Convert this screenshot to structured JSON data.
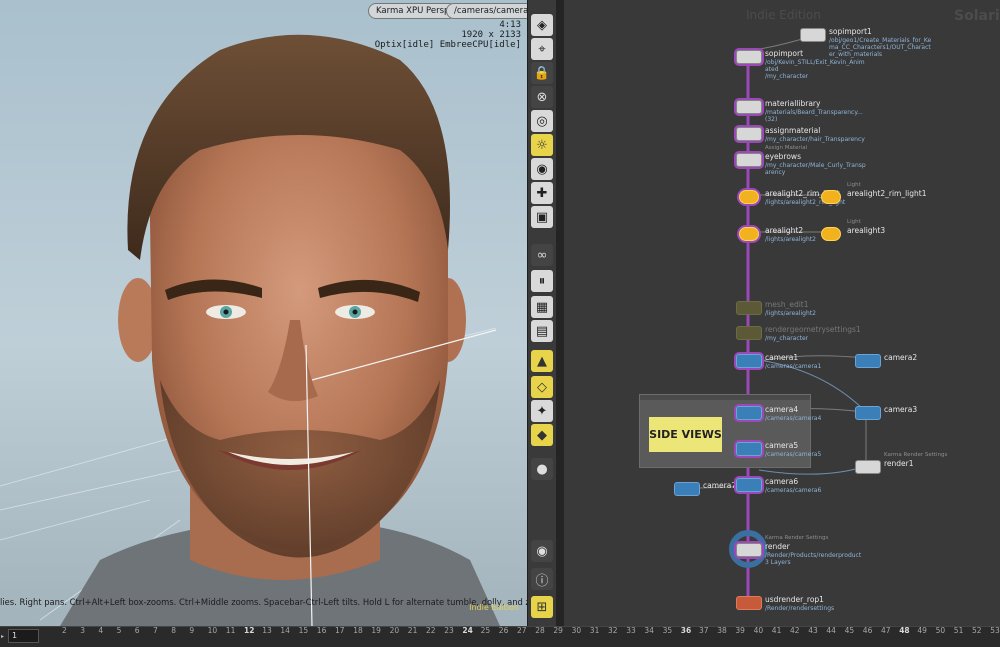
{
  "viewport": {
    "renderer_menu": "Karma XPU Persp",
    "camera_menu": "/cameras/camera4",
    "stats": [
      "4:13",
      "1920 x 2133",
      "Optix[idle] EmbreeCPU[idle]"
    ],
    "help_text": "lies. Right pans. Ctrl+Alt+Left box-zooms. Ctrl+Middle zooms. Spacebar-Ctrl-Left tilts. Hold L for alternate tumble, dolly, and zoom. M or Alt+M for First",
    "edition_label": "Indie Edition"
  },
  "toolbar": {
    "icons": [
      "display-options-icon",
      "snapping-icon",
      "lock-camera-icon",
      "disable-selection-icon",
      "camera-look-icon",
      "light-toggle-icon",
      "headlight-icon",
      "shading-icon",
      "render-region-icon",
      "link-icon",
      "pause-render-icon",
      "ghost-icon",
      "display-geometry-icon",
      "guides-icon",
      "background-icon",
      "grid-icon",
      "snapshot-icon",
      "view-visibility-icon",
      "info-icon",
      "layout-icon"
    ]
  },
  "network": {
    "title": "Indie Edition",
    "brand": "Solaris",
    "sticky_note": "SIDE VIEWS",
    "nodes": [
      {
        "id": "sopimport1",
        "name": "sopimport1",
        "path": "/obj/geo1/Create_Materials_for_Ke\nma_CC_Characters1/OUT_Charact\ner_with_materials",
        "comment": "",
        "kind": "lop",
        "dim": false
      },
      {
        "id": "sopimport",
        "name": "sopimport",
        "path": "/obj/Kevin_STILL/Exit_Kevin_Anim\nated\n/my_character",
        "comment": "",
        "kind": "lop",
        "dim": false
      },
      {
        "id": "materiallibrary",
        "name": "materiallibrary",
        "path": "/materials/Beard_Transparency...\n(32)",
        "comment": "",
        "kind": "lop",
        "dim": false
      },
      {
        "id": "assignmaterial",
        "name": "assignmaterial",
        "path": "/my_character/hair_Transparency",
        "comment": "",
        "kind": "lop",
        "dim": false
      },
      {
        "id": "eyebrows",
        "name": "eyebrows",
        "path": "/my_character/Male_Curly_Transp\narency",
        "comment": "Assign Material",
        "kind": "lop",
        "dim": false
      },
      {
        "id": "arealight2_rim_light",
        "name": "arealight2_rim_light",
        "path": "/lights/arealight2_rim_light",
        "comment": "",
        "kind": "light",
        "dim": false
      },
      {
        "id": "arealight2_rim_light1",
        "name": "arealight2_rim_light1",
        "path": "",
        "comment": "Light",
        "kind": "light",
        "dim": false
      },
      {
        "id": "arealight2",
        "name": "arealight2",
        "path": "/lights/arealight2",
        "comment": "",
        "kind": "light",
        "dim": false
      },
      {
        "id": "arealight3",
        "name": "arealight3",
        "path": "",
        "comment": "Light",
        "kind": "light",
        "dim": false
      },
      {
        "id": "mesh_edit1",
        "name": "mesh_edit1",
        "path": "/lights/arealight2",
        "comment": "",
        "kind": "dim",
        "dim": true
      },
      {
        "id": "rendergeometrysettings1",
        "name": "rendergeometrysettings1",
        "path": "/my_character",
        "comment": "",
        "kind": "dim",
        "dim": true
      },
      {
        "id": "camera1",
        "name": "camera1",
        "path": "/cameras/camera1",
        "comment": "",
        "kind": "cam",
        "dim": false
      },
      {
        "id": "camera2",
        "name": "camera2",
        "path": "",
        "comment": "",
        "kind": "cam",
        "dim": false
      },
      {
        "id": "camera4",
        "name": "camera4",
        "path": "/cameras/camera4",
        "comment": "",
        "kind": "cam",
        "dim": false
      },
      {
        "id": "camera3",
        "name": "camera3",
        "path": "",
        "comment": "",
        "kind": "cam",
        "dim": false
      },
      {
        "id": "camera5",
        "name": "camera5",
        "path": "/cameras/camera5",
        "comment": "",
        "kind": "cam",
        "dim": false
      },
      {
        "id": "render1",
        "name": "render1",
        "path": "",
        "comment": "Karma Render Settings",
        "kind": "render",
        "dim": false
      },
      {
        "id": "camera7",
        "name": "camera7",
        "path": "",
        "comment": "",
        "kind": "cam",
        "dim": false
      },
      {
        "id": "camera6",
        "name": "camera6",
        "path": "/cameras/camera6",
        "comment": "",
        "kind": "cam",
        "dim": false
      },
      {
        "id": "render",
        "name": "render",
        "path": "/Render/Products/renderproduct\n3 Layers",
        "comment": "Karma Render Settings",
        "kind": "render",
        "dim": false
      },
      {
        "id": "usdrender_rop1",
        "name": "usdrender_rop1",
        "path": "/Render/rendersettings",
        "comment": "",
        "kind": "usd",
        "dim": false
      }
    ]
  },
  "timeline": {
    "current_frame": "1",
    "ticks": [
      "2",
      "3",
      "4",
      "5",
      "6",
      "7",
      "8",
      "9",
      "10",
      "11",
      "12",
      "13",
      "14",
      "15",
      "16",
      "17",
      "18",
      "19",
      "20",
      "21",
      "22",
      "23",
      "24",
      "25",
      "26",
      "27",
      "28",
      "29",
      "30",
      "31",
      "32",
      "33",
      "34",
      "35",
      "36",
      "37",
      "38",
      "39",
      "40",
      "41",
      "42",
      "43",
      "44",
      "45",
      "46",
      "47",
      "48",
      "49",
      "50",
      "51",
      "52",
      "53"
    ],
    "major_ticks": [
      "12",
      "24",
      "36",
      "48"
    ]
  },
  "colors": {
    "accent_wire": "#9b48b8",
    "camera_node": "#3b7fb8",
    "light_node": "#f2b21e",
    "sticky_note": "#ece679",
    "edition_text": "#e4d05a"
  }
}
